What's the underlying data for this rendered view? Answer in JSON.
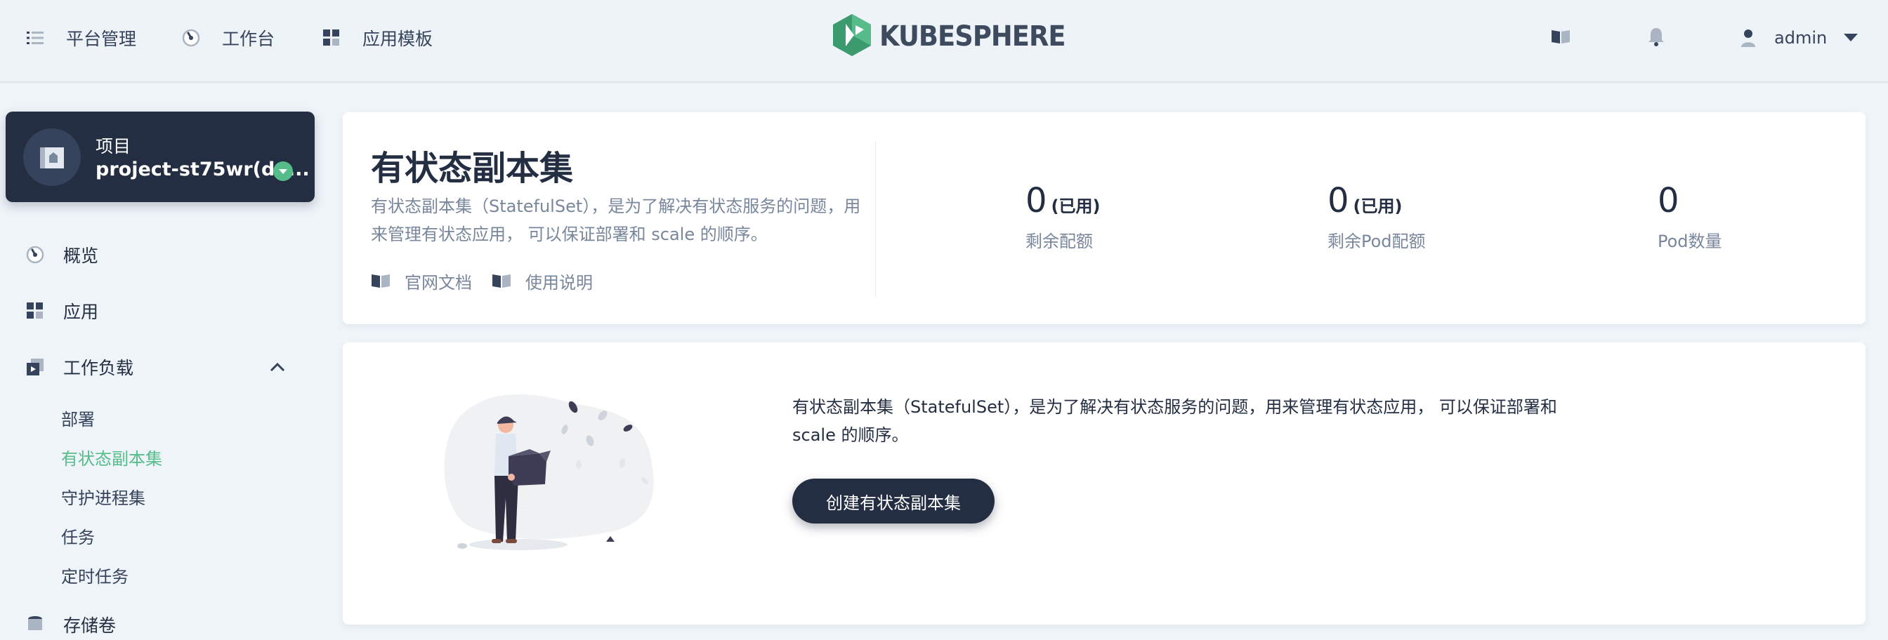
{
  "nav": {
    "platform_label": "平台管理",
    "workbench_label": "工作台",
    "app_templates_label": "应用模板",
    "logo_text": "KUBESPHERE",
    "user_name": "admin"
  },
  "project": {
    "type_label": "项目",
    "name": "project-st75wr(do..."
  },
  "sidebar": {
    "overview": "概览",
    "apps": "应用",
    "workloads": "工作负载",
    "sub": [
      "部署",
      "有状态副本集",
      "守护进程集",
      "任务",
      "定时任务"
    ],
    "storage": "存储卷"
  },
  "banner": {
    "title": "有状态副本集",
    "description": "有状态副本集（StatefulSet），是为了解决有状态服务的问题，用来管理有状态应用， 可以保证部署和 scale 的顺序。",
    "link_docs": "官网文档",
    "link_usage": "使用说明",
    "stats": [
      {
        "value": "0",
        "unit": "(已用)",
        "label": "剩余配额"
      },
      {
        "value": "0",
        "unit": "(已用)",
        "label": "剩余Pod配额"
      },
      {
        "value": "0",
        "unit": "",
        "label": "Pod数量"
      }
    ]
  },
  "empty": {
    "text": "有状态副本集（StatefulSet），是为了解决有状态服务的问题，用来管理有状态应用， 可以保证部署和 scale 的顺序。",
    "create_label": "创建有状态副本集"
  },
  "colors": {
    "accent": "#55bc8a",
    "dark": "#242e42",
    "muted": "#79879c",
    "background": "#eff4f9"
  }
}
